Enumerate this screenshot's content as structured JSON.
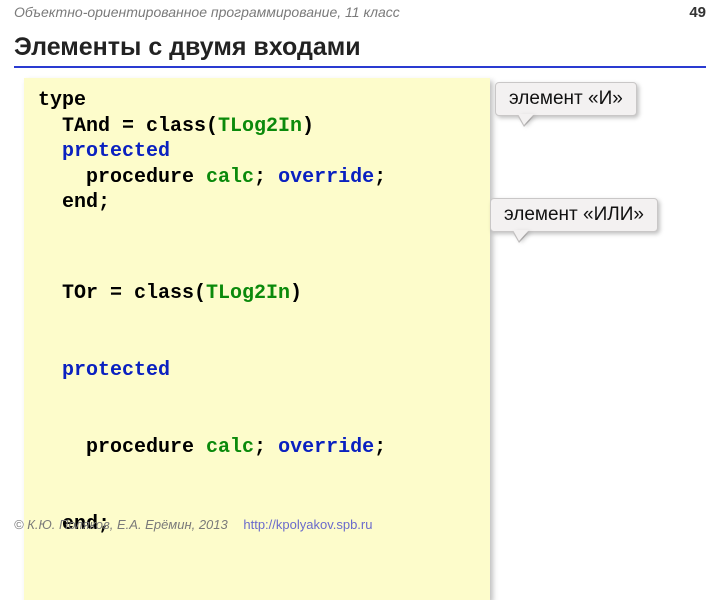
{
  "header": {
    "course": "Объектно-ориентированное программирование, 11 класс",
    "page": "49"
  },
  "title": "Элементы с двумя входами",
  "code": {
    "l1a": "type",
    "l2a": "  TAnd = class(",
    "l2b": "TLog2In",
    "l2c": ")",
    "l3a": "  ",
    "l3b": "protected",
    "l4a": "    procedure ",
    "l4b": "calc",
    "l4c": "; ",
    "l4d": "override",
    "l4e": ";",
    "l5a": "  end;",
    "l6a": "  TOr = class(",
    "l6b": "TLog2In",
    "l6c": ")",
    "l7a": "  ",
    "l7b": "protected",
    "l8a": "    procedure ",
    "l8b": "calc",
    "l8c": "; ",
    "l8d": "override",
    "l8e": ";",
    "l9a": "  end;"
  },
  "callouts": {
    "and": "элемент «И»",
    "or": "элемент «ИЛИ»"
  },
  "footer": {
    "copyright": "© К.Ю. Поляков, Е.А. Ерёмин, 2013",
    "url": "http://kpolyakov.spb.ru"
  }
}
